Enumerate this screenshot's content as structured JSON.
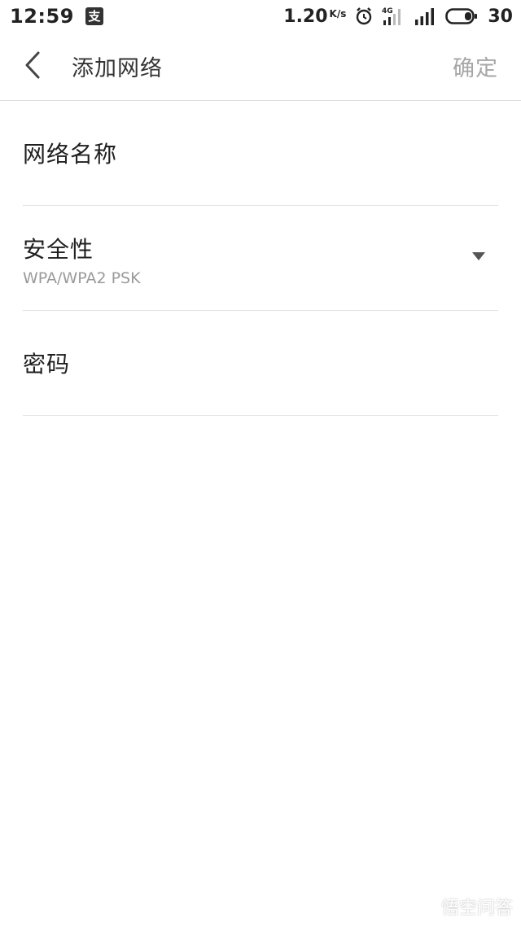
{
  "status_bar": {
    "time": "12:59",
    "app_icon_glyph": "支",
    "net_speed": "1.20",
    "net_speed_unit": "K/s",
    "network_type": "4G",
    "battery_level": "30",
    "icons": [
      "alipay-icon",
      "alarm-icon",
      "signal-4g-icon",
      "signal-icon",
      "battery-icon"
    ]
  },
  "header": {
    "title": "添加网络",
    "confirm_label": "确定",
    "back_icon": "chevron-left-icon"
  },
  "form": {
    "network_name": {
      "label": "网络名称",
      "value": ""
    },
    "security": {
      "label": "安全性",
      "value": "WPA/WPA2 PSK",
      "icon": "dropdown-arrow-icon"
    },
    "password": {
      "label": "密码",
      "value": ""
    }
  },
  "watermark": {
    "text": "悟空问答",
    "icon": "wukong-logo-icon"
  },
  "colors": {
    "background": "#ffffff",
    "title": "#333333",
    "confirm_disabled": "#a6a6a6",
    "secondary_text": "#9a9a9a",
    "divider": "#e3e3e3"
  }
}
